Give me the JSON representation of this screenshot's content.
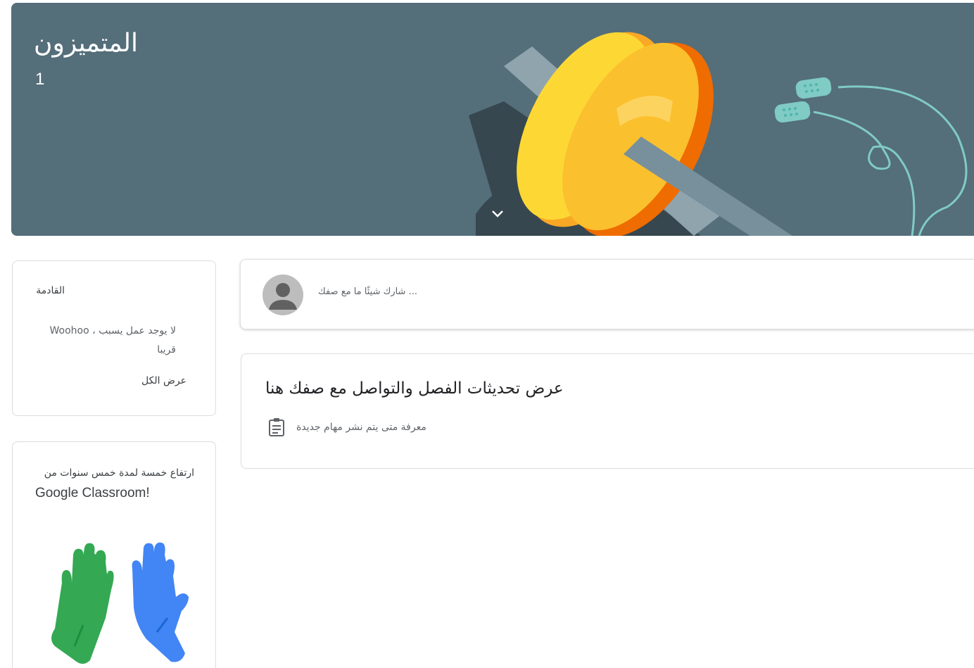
{
  "banner": {
    "class_name": "المتميزون",
    "section": "1",
    "background_color": "#546e7a",
    "illustration_icon": "weight-plate-and-earphones-illustration",
    "expand_icon": "chevron-down-icon"
  },
  "upcoming": {
    "title": "القادمة",
    "message": "لا يوجد عمل يسبب ، Woohoo قريبا",
    "view_all": "عرض الكل"
  },
  "promo": {
    "line1": "ارتفاع خمسة لمدة خمس سنوات من",
    "line2": "Google Classroom!",
    "illustration_icon": "high-five-hands-illustration"
  },
  "share": {
    "placeholder": "... شارك شيئًا ما مع صفك",
    "avatar_icon": "default-avatar-icon"
  },
  "info": {
    "heading": "عرض تحديثات الفصل والتواصل مع صفك هنا",
    "subtext": "معرفة متى يتم نشر مهام جديدة",
    "icon": "assignment-icon"
  }
}
